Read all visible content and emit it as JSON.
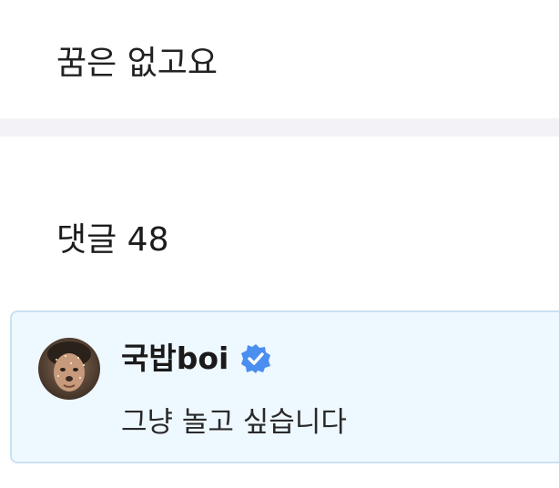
{
  "post": {
    "text": "꿈은 없고요"
  },
  "comments": {
    "header": "댓글 48",
    "items": [
      {
        "author": "국밥boi",
        "verified": true,
        "avatar_icon": "user-avatar",
        "text": "그냥 놀고 싶습니다"
      }
    ]
  },
  "colors": {
    "divider": "#f3f3f7",
    "card_background": "#eef8ff",
    "card_border": "#c9e1f3",
    "verified_badge": "#4a8ff0"
  }
}
